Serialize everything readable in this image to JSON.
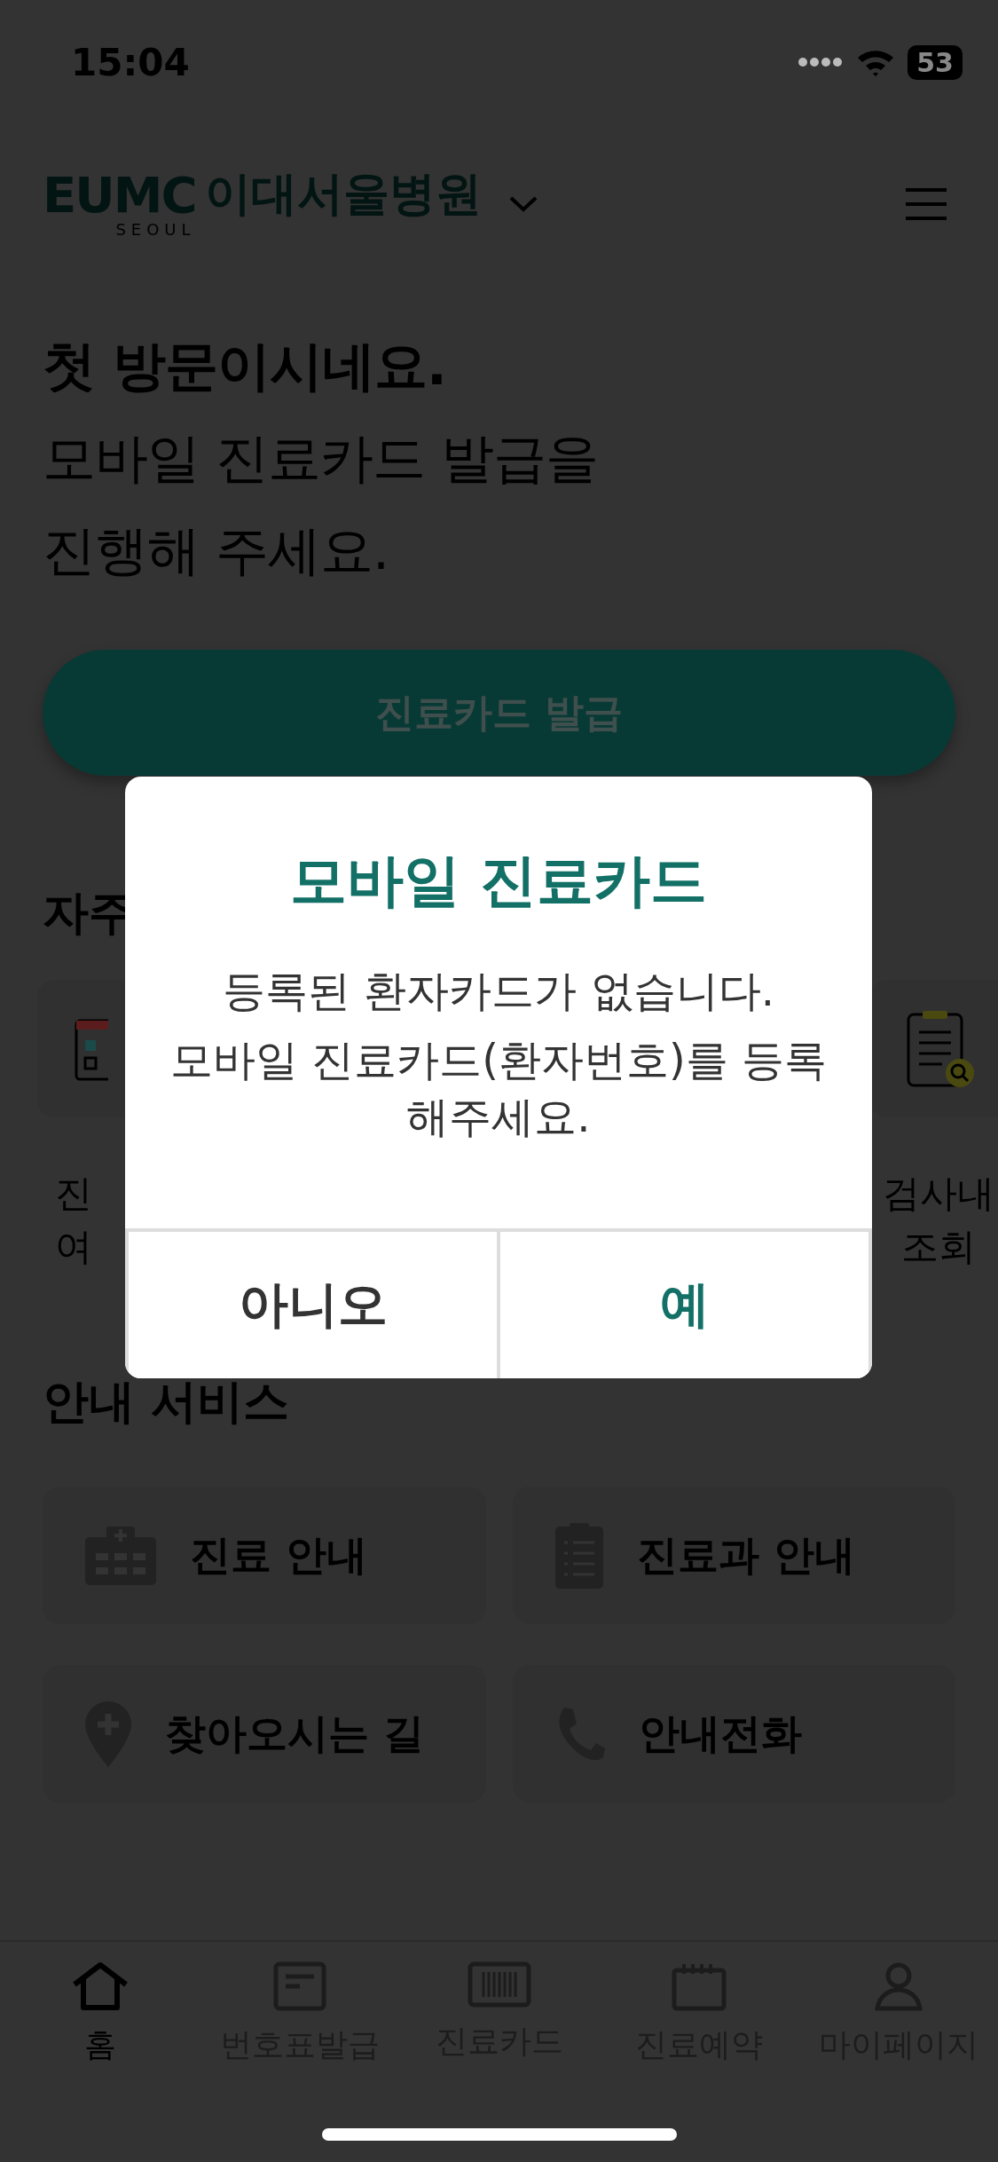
{
  "status_bar": {
    "time": "15:04",
    "battery": "53"
  },
  "header": {
    "logo_text": "EUMC",
    "logo_sub": "SEOUL",
    "hospital_name": "이대서울병원"
  },
  "greeting": {
    "lines": [
      "첫 방문이시네요.",
      "모바일 진료카드 발급을",
      "진행해 주세요."
    ]
  },
  "issue_button": {
    "label": "진료카드 발급"
  },
  "frequent_section": {
    "title": "자주",
    "items": [
      {
        "label_lines": [
          "진",
          "여"
        ],
        "kind": "calendar"
      },
      {
        "label_lines": [
          "검사내",
          "조회"
        ],
        "kind": "clipboard-search"
      }
    ]
  },
  "guide_section": {
    "title": "안내 서비스",
    "items": [
      {
        "label": "진료 안내",
        "kind": "hospital"
      },
      {
        "label": "진료과 안내",
        "kind": "clipboard"
      },
      {
        "label": "찾아오시는 길",
        "kind": "pin"
      },
      {
        "label": "안내전화",
        "kind": "phone"
      }
    ]
  },
  "bottom_nav": [
    {
      "label": "홈",
      "kind": "home",
      "selected": true
    },
    {
      "label": "번호표발급",
      "kind": "ticket",
      "selected": false
    },
    {
      "label": "진료카드",
      "kind": "card",
      "selected": false
    },
    {
      "label": "진료예약",
      "kind": "calendar",
      "selected": false
    },
    {
      "label": "마이페이지",
      "kind": "person",
      "selected": false
    }
  ],
  "dialog": {
    "title": "모바일 진료카드",
    "messages": [
      "등록된 환자카드가 없습니다.",
      "모바일 진료카드(환자번호)를 등록해주세요."
    ],
    "buttons": [
      {
        "label": "아니오",
        "kind": "cancel"
      },
      {
        "label": "예",
        "kind": "confirm"
      }
    ]
  }
}
